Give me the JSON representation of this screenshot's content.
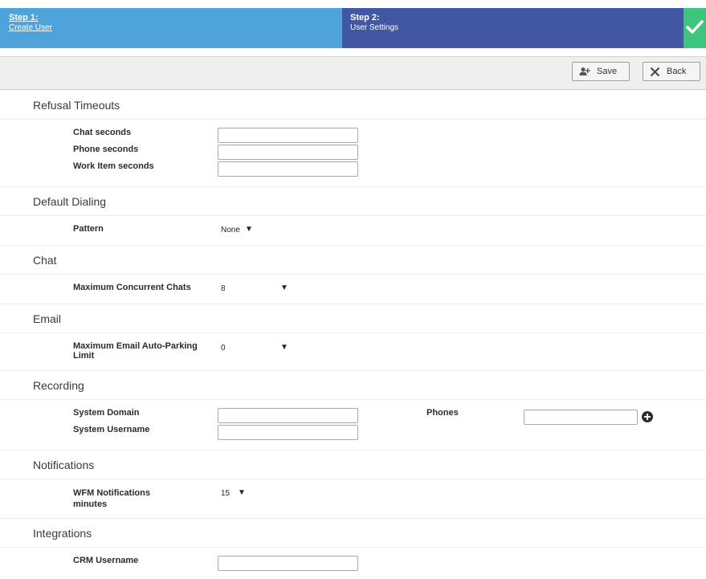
{
  "wizard": {
    "step1": {
      "title": "Step 1:",
      "label": "Create User"
    },
    "step2": {
      "title": "Step 2:",
      "label": "User Settings"
    },
    "complete_icon": "check-icon"
  },
  "toolbar": {
    "save_label": "Save",
    "back_label": "Back",
    "save_icon": "add-user-icon",
    "back_icon": "close-x-icon"
  },
  "refusal_timeouts": {
    "title": "Refusal Timeouts",
    "chat_label": "Chat seconds",
    "chat_value": "",
    "phone_label": "Phone seconds",
    "phone_value": "",
    "work_item_label": "Work Item seconds",
    "work_item_value": ""
  },
  "default_dialing": {
    "title": "Default Dialing",
    "pattern_label": "Pattern",
    "pattern_value": "None"
  },
  "chat": {
    "title": "Chat",
    "max_chats_label": "Maximum Concurrent Chats",
    "max_chats_value": "8"
  },
  "email": {
    "title": "Email",
    "auto_parking_label_1": "Maximum Email Auto-Parking",
    "auto_parking_label_2": "Limit",
    "auto_parking_value": "0"
  },
  "recording": {
    "title": "Recording",
    "domain_label": "System Domain",
    "domain_value": "",
    "username_label": "System Username",
    "username_value": "",
    "phones_label": "Phones",
    "phones_value": ""
  },
  "notifications": {
    "title": "Notifications",
    "wfm_label_1": "WFM Notifications",
    "wfm_label_2": "minutes",
    "wfm_value": "15"
  },
  "integrations": {
    "title": "Integrations",
    "crm_label": "CRM Username",
    "crm_value": ""
  },
  "dropdown_arrow": "▼"
}
